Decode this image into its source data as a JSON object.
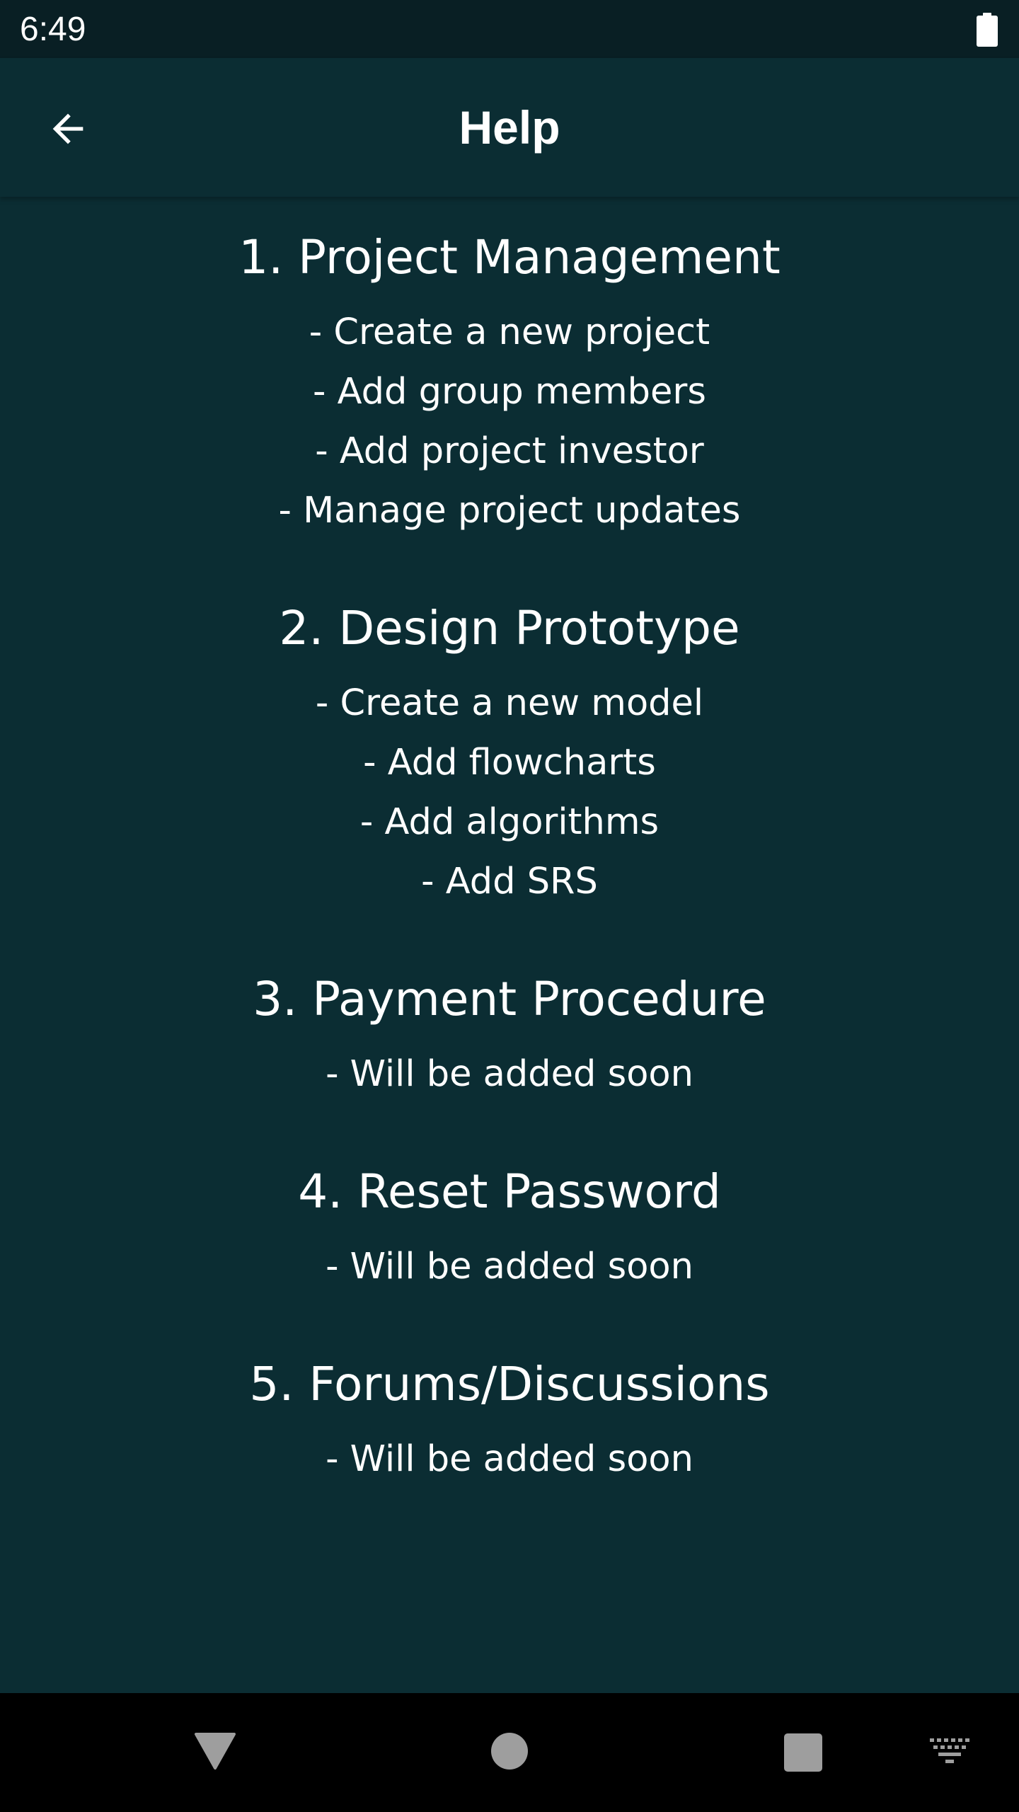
{
  "status_bar": {
    "time": "6:49",
    "battery_icon": "battery-full-icon"
  },
  "app_bar": {
    "title": "Help",
    "back_icon": "arrow-left-icon"
  },
  "sections": [
    {
      "title": "1. Project Management",
      "items": [
        "- Create a new project",
        "- Add group members",
        "- Add project investor",
        "- Manage project updates"
      ]
    },
    {
      "title": "2. Design Prototype",
      "items": [
        "- Create a new model",
        "- Add flowcharts",
        "- Add algorithms",
        "- Add SRS"
      ]
    },
    {
      "title": "3. Payment Procedure",
      "items": [
        "- Will be added soon"
      ]
    },
    {
      "title": "4. Reset Password",
      "items": [
        "- Will be added soon"
      ]
    },
    {
      "title": "5. Forums/Discussions",
      "items": [
        "- Will be added soon"
      ]
    }
  ],
  "nav_bar": {
    "back_icon": "triangle-back-icon",
    "home_icon": "circle-home-icon",
    "recents_icon": "square-recents-icon",
    "keyboard_icon": "keyboard-icon"
  },
  "colors": {
    "background": "#0b2d33",
    "status_bar": "#091f24",
    "nav_bar": "#000000",
    "text": "#ffffff",
    "nav_icons": "#9e9e9e"
  }
}
